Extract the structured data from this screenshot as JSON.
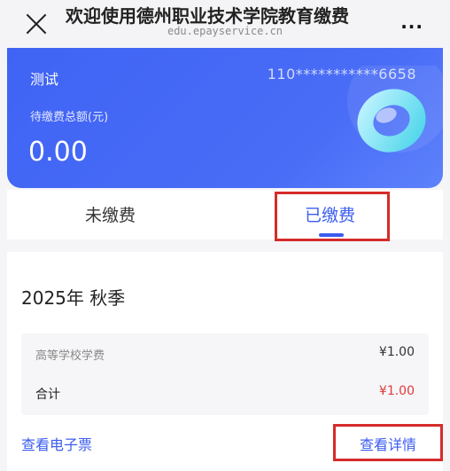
{
  "header": {
    "title": "欢迎使用德州职业技术学院教育缴费",
    "url": "edu.epayservice.cn",
    "more": "···"
  },
  "card": {
    "name": "测试",
    "account": "110***********6658",
    "amount_label": "待缴费总额(元)",
    "amount": "0.00"
  },
  "tabs": [
    {
      "label": "未缴费",
      "active": false
    },
    {
      "label": "已缴费",
      "active": true
    }
  ],
  "record": {
    "season": "2025年 秋季",
    "fee_name": "高等学校学费",
    "fee_amount": "¥1.00",
    "total_label": "合计",
    "total_amount": "¥1.00"
  },
  "actions": {
    "invoice": "查看电子票",
    "detail": "查看详情"
  },
  "colors": {
    "primary": "#3b5cf0",
    "highlight": "#d62b2b",
    "total": "#e03a3a"
  }
}
